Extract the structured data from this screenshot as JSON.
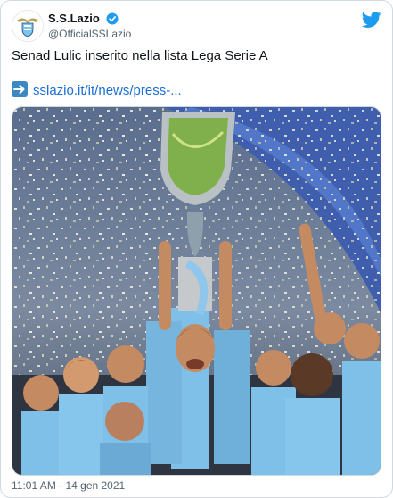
{
  "tweet": {
    "display_name": "S.S.Lazio",
    "handle": "@OfficialSSLazio",
    "text": "Senad Lulic inserito nella lista Lega Serie A",
    "link_text": "sslazio.it/it/news/press-...",
    "timestamp": "11:01 AM · 14 gen 2021"
  },
  "icons": {
    "avatar": "lazio-eagle-crest-icon",
    "verified": "verified-badge-icon",
    "platform": "twitter-bird-icon",
    "link_prefix": "right-arrow-emoji-icon"
  },
  "colors": {
    "accent": "#1d9bf0",
    "link": "#1b6fd8",
    "secondary_text": "#536471",
    "border": "#cfd9de"
  }
}
